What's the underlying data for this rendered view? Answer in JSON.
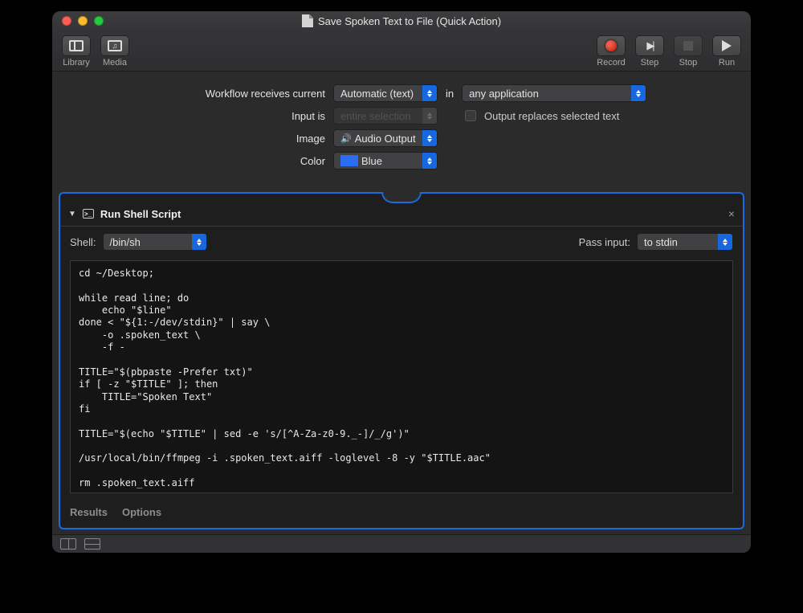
{
  "window": {
    "title": "Save Spoken Text to File (Quick Action)"
  },
  "toolbar": {
    "library": "Library",
    "media": "Media",
    "record": "Record",
    "step": "Step",
    "stop": "Stop",
    "run": "Run"
  },
  "config": {
    "workflow_receives_label": "Workflow receives current",
    "workflow_receives_value": "Automatic (text)",
    "in_label": "in",
    "application_value": "any application",
    "input_is_label": "Input is",
    "input_is_value": "entire selection",
    "output_replaces_label": "Output replaces selected text",
    "image_label": "Image",
    "image_value": "Audio Output",
    "color_label": "Color",
    "color_value": "Blue"
  },
  "action": {
    "title": "Run Shell Script",
    "shell_label": "Shell:",
    "shell_value": "/bin/sh",
    "pass_input_label": "Pass input:",
    "pass_input_value": "to stdin",
    "script": "cd ~/Desktop;\n\nwhile read line; do\n    echo \"$line\"\ndone < \"${1:-/dev/stdin}\" | say \\\n    -o .spoken_text \\\n    -f -\n\nTITLE=\"$(pbpaste -Prefer txt)\"\nif [ -z \"$TITLE\" ]; then\n    TITLE=\"Spoken Text\"\nfi\n\nTITLE=\"$(echo \"$TITLE\" | sed -e 's/[^A-Za-z0-9._-]/_/g')\"\n\n/usr/local/bin/ffmpeg -i .spoken_text.aiff -loglevel -8 -y \"$TITLE.aac\"\n\nrm .spoken_text.aiff",
    "results_label": "Results",
    "options_label": "Options"
  }
}
